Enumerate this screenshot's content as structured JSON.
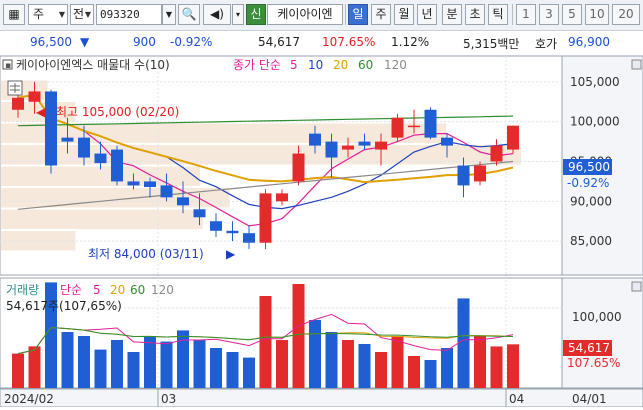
{
  "toolbar": {
    "market": "주",
    "type_label": "전",
    "code": "093320",
    "name": "케이아이엔",
    "new_label": "신",
    "period_tabs": [
      "일",
      "주",
      "월",
      "년",
      "분",
      "초",
      "틱"
    ],
    "active_period": "일",
    "numbers": [
      "1",
      "3",
      "5",
      "10",
      "20"
    ]
  },
  "status": {
    "price": "96,500",
    "change_icon": "down-triangle",
    "change": "900",
    "change_pct": "-0.92%",
    "volume": "54,617",
    "volume_ratio": "107.65%",
    "turnover": "1.12%",
    "amount": "5,315백만",
    "ask_label": "호가",
    "ask_price": "96,900"
  },
  "chart": {
    "price_title": "케이아이엔엑스 매물대 수(10)",
    "ma_prefix": "종가 단순",
    "ma_periods": [
      "5",
      "10",
      "20",
      "60",
      "120"
    ],
    "ma_colors": [
      "#e0209a",
      "#2040c0",
      "#e0a000",
      "#2f8f2f",
      "#8a8a8a"
    ],
    "high_label": "최고 105,000 (02/20)",
    "low_label": "최저 84,000 (03/11)",
    "price_axis": [
      "105,000",
      "100,000",
      "95,000",
      "90,000",
      "85,000"
    ],
    "last_price_tag": "96,500",
    "last_change_tag": "-0.92%",
    "volume_title": "거래량",
    "vol_ma_prefix": "단순",
    "vol_ma_periods": [
      "5",
      "20",
      "60",
      "120"
    ],
    "vol_info": "54,617주(107,65%)",
    "volume_axis": [
      "100,000"
    ],
    "last_vol_tag": "54,617",
    "last_vol_pct_tag": "107.65%",
    "date_labels": [
      "2024/02",
      "03",
      "04",
      "04/01"
    ],
    "colors": {
      "up": "#e32b2b",
      "down": "#1f5fd3"
    }
  },
  "chart_data": {
    "type": "candlestick",
    "y_price_range": [
      81000,
      108000
    ],
    "y_volume_range": [
      0,
      135000
    ],
    "candles": [
      {
        "o": 101500,
        "h": 103500,
        "l": 100500,
        "c": 103000,
        "v": 43000
      },
      {
        "o": 102500,
        "h": 105000,
        "l": 101000,
        "c": 103800,
        "v": 52000
      },
      {
        "o": 103800,
        "h": 104000,
        "l": 93500,
        "c": 94500,
        "v": 132000
      },
      {
        "o": 98000,
        "h": 100500,
        "l": 96000,
        "c": 97500,
        "v": 70000
      },
      {
        "o": 98000,
        "h": 99500,
        "l": 94500,
        "c": 95500,
        "v": 65000
      },
      {
        "o": 96000,
        "h": 97500,
        "l": 94000,
        "c": 94800,
        "v": 48000
      },
      {
        "o": 96500,
        "h": 97000,
        "l": 92000,
        "c": 92500,
        "v": 60000
      },
      {
        "o": 92500,
        "h": 93500,
        "l": 91500,
        "c": 92000,
        "v": 45000
      },
      {
        "o": 92500,
        "h": 93000,
        "l": 90500,
        "c": 91800,
        "v": 65000
      },
      {
        "o": 92000,
        "h": 93500,
        "l": 90000,
        "c": 90500,
        "v": 58000
      },
      {
        "o": 90500,
        "h": 92500,
        "l": 88500,
        "c": 89500,
        "v": 72000
      },
      {
        "o": 89000,
        "h": 91000,
        "l": 87000,
        "c": 88000,
        "v": 60000
      },
      {
        "o": 87500,
        "h": 88500,
        "l": 85500,
        "c": 86300,
        "v": 50000
      },
      {
        "o": 86300,
        "h": 87500,
        "l": 85000,
        "c": 86000,
        "v": 45000
      },
      {
        "o": 86000,
        "h": 87000,
        "l": 84000,
        "c": 84800,
        "v": 38000
      },
      {
        "o": 84800,
        "h": 91500,
        "l": 84000,
        "c": 91000,
        "v": 115000
      },
      {
        "o": 90000,
        "h": 91500,
        "l": 89500,
        "c": 91000,
        "v": 60000
      },
      {
        "o": 92500,
        "h": 97000,
        "l": 92000,
        "c": 96000,
        "v": 130000
      },
      {
        "o": 98500,
        "h": 99500,
        "l": 96000,
        "c": 97000,
        "v": 85000
      },
      {
        "o": 97500,
        "h": 98500,
        "l": 93000,
        "c": 95500,
        "v": 70000
      },
      {
        "o": 96500,
        "h": 98000,
        "l": 95500,
        "c": 97000,
        "v": 60000
      },
      {
        "o": 97500,
        "h": 98500,
        "l": 96500,
        "c": 97000,
        "v": 55000
      },
      {
        "o": 96500,
        "h": 98500,
        "l": 94500,
        "c": 97500,
        "v": 45000
      },
      {
        "o": 98000,
        "h": 101000,
        "l": 97500,
        "c": 100500,
        "v": 65000
      },
      {
        "o": 99500,
        "h": 101500,
        "l": 98500,
        "c": 99500,
        "v": 40000
      },
      {
        "o": 101500,
        "h": 101800,
        "l": 97800,
        "c": 98000,
        "v": 35000
      },
      {
        "o": 98000,
        "h": 98500,
        "l": 95500,
        "c": 97000,
        "v": 50000
      },
      {
        "o": 94500,
        "h": 95500,
        "l": 90500,
        "c": 92000,
        "v": 112000
      },
      {
        "o": 92500,
        "h": 95000,
        "l": 92000,
        "c": 94500,
        "v": 65000
      },
      {
        "o": 95000,
        "h": 97800,
        "l": 94500,
        "c": 97000,
        "v": 52000
      },
      {
        "o": 96500,
        "h": 99500,
        "l": 96000,
        "c": 99500,
        "v": 54617
      }
    ]
  }
}
